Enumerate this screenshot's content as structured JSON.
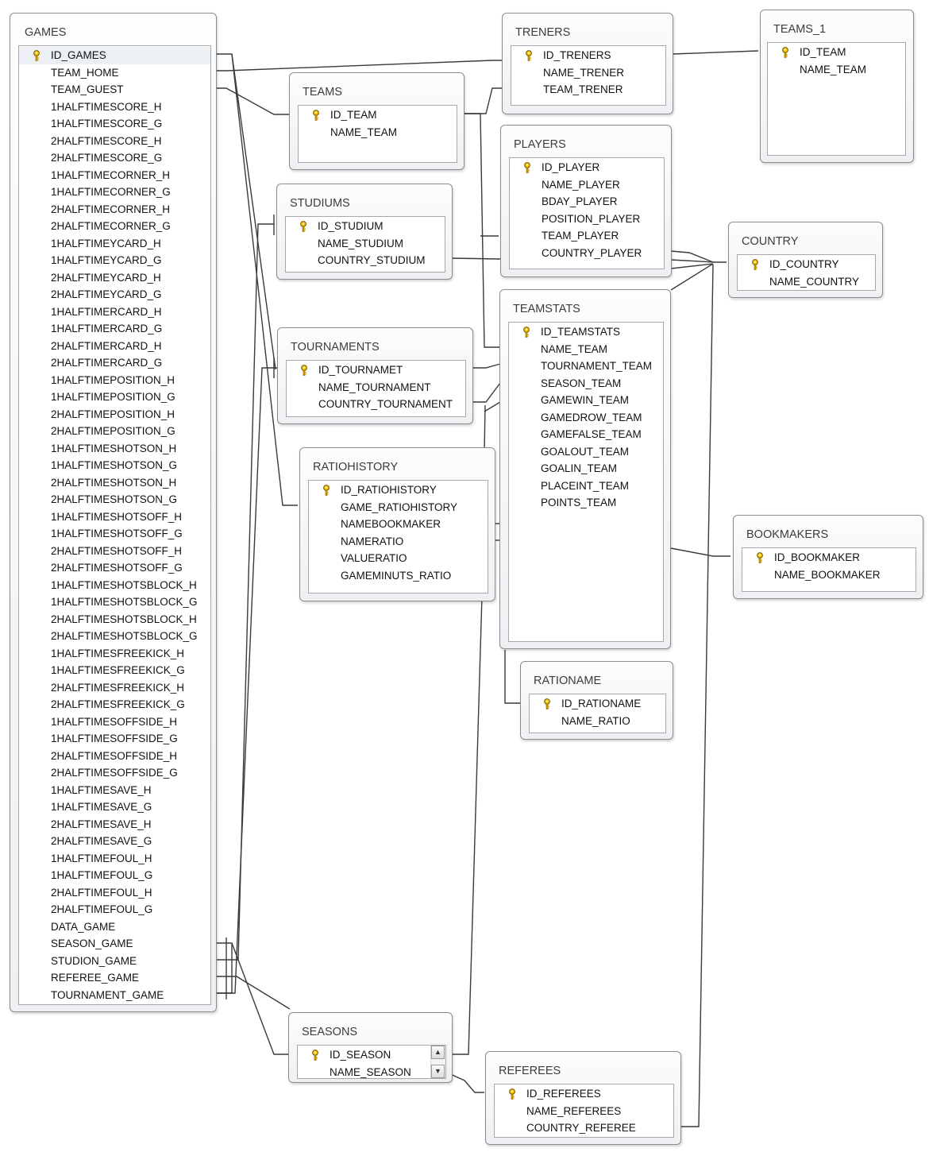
{
  "tables": {
    "games": {
      "name": "GAMES",
      "fields": [
        "ID_GAMES",
        "TEAM_HOME",
        "TEAM_GUEST",
        "1HALFTIMESCORE_H",
        "1HALFTIMESCORE_G",
        "2HALFTIMESCORE_H",
        "2HALFTIMESCORE_G",
        "1HALFTIMECORNER_H",
        "1HALFTIMECORNER_G",
        "2HALFTIMECORNER_H",
        "2HALFTIMECORNER_G",
        "1HALFTIMEYCARD_H",
        "1HALFTIMEYCARD_G",
        "2HALFTIMEYCARD_H",
        "2HALFTIMEYCARD_G",
        "1HALFTIMERCARD_H",
        "1HALFTIMERCARD_G",
        "2HALFTIMERCARD_H",
        "2HALFTIMERCARD_G",
        "1HALFTIMEPOSITION_H",
        "1HALFTIMEPOSITION_G",
        "2HALFTIMEPOSITION_H",
        "2HALFTIMEPOSITION_G",
        "1HALFTIMESHOTSON_H",
        "1HALFTIMESHOTSON_G",
        "2HALFTIMESHOTSON_H",
        "2HALFTIMESHOTSON_G",
        "1HALFTIMESHOTSOFF_H",
        "1HALFTIMESHOTSOFF_G",
        "2HALFTIMESHOTSOFF_H",
        "2HALFTIMESHOTSOFF_G",
        "1HALFTIMESHOTSBLOCK_H",
        "1HALFTIMESHOTSBLOCK_G",
        "2HALFTIMESHOTSBLOCK_H",
        "2HALFTIMESHOTSBLOCK_G",
        "1HALFTIMESFREEKICK_H",
        "1HALFTIMESFREEKICK_G",
        "2HALFTIMESFREEKICK_H",
        "2HALFTIMESFREEKICK_G",
        "1HALFTIMESOFFSIDE_H",
        "1HALFTIMESOFFSIDE_G",
        "2HALFTIMESOFFSIDE_H",
        "2HALFTIMESOFFSIDE_G",
        "1HALFTIMESAVE_H",
        "1HALFTIMESAVE_G",
        "2HALFTIMESAVE_H",
        "2HALFTIMESAVE_G",
        "1HALFTIMEFOUL_H",
        "1HALFTIMEFOUL_G",
        "2HALFTIMEFOUL_H",
        "2HALFTIMEFOUL_G",
        "DATA_GAME",
        "SEASON_GAME",
        "STUDION_GAME",
        "REFEREE_GAME",
        "TOURNAMENT_GAME"
      ],
      "key_field": "ID_GAMES"
    },
    "trainers": {
      "name": "TRENERS",
      "fields": [
        "ID_TRENERS",
        "NAME_TRENER",
        "TEAM_TRENER"
      ],
      "key_field": "ID_TRENERS"
    },
    "teams_1": {
      "name": "TEAMS_1",
      "fields": [
        "ID_TEAM",
        "NAME_TEAM"
      ],
      "key_field": "ID_TEAM"
    },
    "teams": {
      "name": "TEAMS",
      "fields": [
        "ID_TEAM",
        "NAME_TEAM"
      ],
      "key_field": "ID_TEAM"
    },
    "players": {
      "name": "PLAYERS",
      "fields": [
        "ID_PLAYER",
        "NAME_PLAYER",
        "BDAY_PLAYER",
        "POSITION_PLAYER",
        "TEAM_PLAYER",
        "COUNTRY_PLAYER"
      ],
      "key_field": "ID_PLAYER"
    },
    "stadiums": {
      "name": "STUDIUMS",
      "fields": [
        "ID_STUDIUM",
        "NAME_STUDIUM",
        "COUNTRY_STUDIUM"
      ],
      "key_field": "ID_STUDIUM"
    },
    "country": {
      "name": "COUNTRY",
      "fields": [
        "ID_COUNTRY",
        "NAME_COUNTRY"
      ],
      "key_field": "ID_COUNTRY"
    },
    "tournaments": {
      "name": "TOURNAMENTS",
      "fields": [
        "ID_TOURNAMET",
        "NAME_TOURNAMENT",
        "COUNTRY_TOURNAMENT"
      ],
      "key_field": "ID_TOURNAMET"
    },
    "teamstats": {
      "name": "TEAMSTATS",
      "fields": [
        "ID_TEAMSTATS",
        "NAME_TEAM",
        "TOURNAMENT_TEAM",
        "SEASON_TEAM",
        "GAMEWIN_TEAM",
        "GAMEDROW_TEAM",
        "GAMEFALSE_TEAM",
        "GOALOUT_TEAM",
        "GOALIN_TEAM",
        "PLACEINT_TEAM",
        "POINTS_TEAM"
      ],
      "key_field": "ID_TEAMSTATS"
    },
    "ratiohistory": {
      "name": "RATIOHISTORY",
      "fields": [
        "ID_RATIOHISTORY",
        "GAME_RATIOHISTORY",
        "NAMEBOOKMAKER",
        "NAMERATIO",
        "VALUERATIO",
        "GAMEMINUTS_RATIO"
      ],
      "key_field": "ID_RATIOHISTORY"
    },
    "bookmakers": {
      "name": "BOOKMAKERS",
      "fields": [
        "ID_BOOKMAKER",
        "NAME_BOOKMAKER"
      ],
      "key_field": "ID_BOOKMAKER"
    },
    "rationame": {
      "name": "RATIONAME",
      "fields": [
        "ID_RATIONAME",
        "NAME_RATIO"
      ],
      "key_field": "ID_RATIONAME"
    },
    "seasons": {
      "name": "SEASONS",
      "fields": [
        "ID_SEASON",
        "NAME_SEASON"
      ],
      "key_field": "ID_SEASON"
    },
    "referees": {
      "name": "REFEREES",
      "fields": [
        "ID_REFEREES",
        "NAME_REFEREES",
        "COUNTRY_REFEREE"
      ],
      "key_field": "ID_REFEREES"
    }
  },
  "icons": {
    "primary_key": "key-icon",
    "scroll_up": "scroll-up-icon",
    "scroll_down": "scroll-down-icon"
  },
  "colors": {
    "relationship_line": "#3a3a3a",
    "table_border": "#8c8c8c"
  }
}
